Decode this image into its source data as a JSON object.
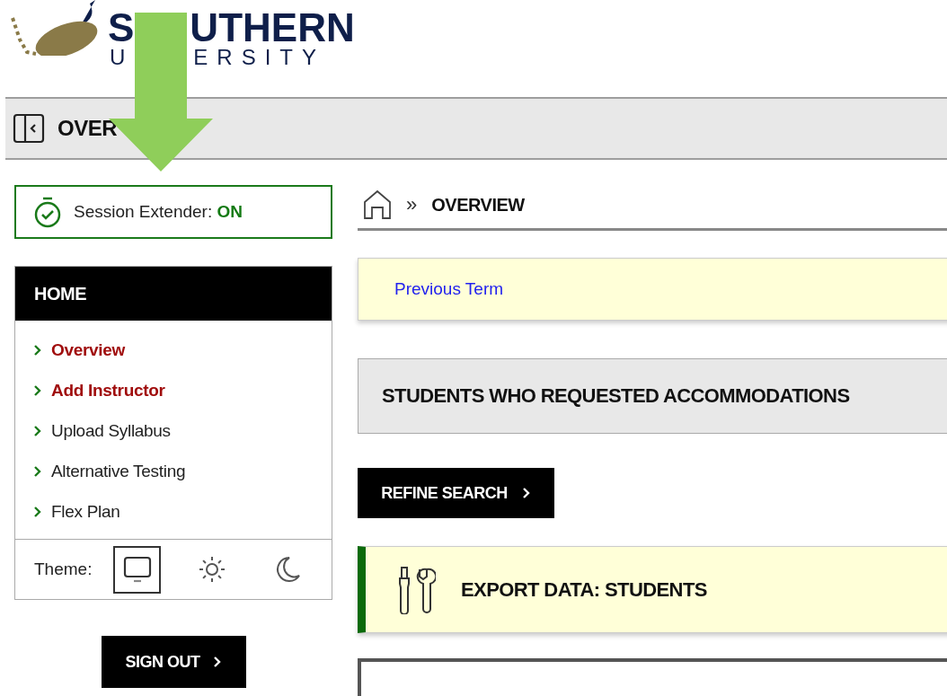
{
  "logo": {
    "top_parts": [
      "S",
      "UTHERN"
    ],
    "bottom_parts": [
      "U",
      "ERSITY"
    ]
  },
  "header": {
    "title": "OVER"
  },
  "session_extender": {
    "label": "Session Extender:",
    "status": "ON",
    "on": true
  },
  "sidebar": {
    "title": "HOME",
    "items": [
      {
        "label": "Overview",
        "highlighted": true
      },
      {
        "label": "Add Instructor",
        "highlighted": true
      },
      {
        "label": "Upload Syllabus",
        "highlighted": false
      },
      {
        "label": "Alternative Testing",
        "highlighted": false
      },
      {
        "label": "Flex Plan",
        "highlighted": false
      }
    ],
    "theme": {
      "label": "Theme:",
      "options": [
        {
          "kind": "system",
          "selected": true
        },
        {
          "kind": "light",
          "selected": false
        },
        {
          "kind": "dark",
          "selected": false
        }
      ]
    }
  },
  "sign_out": {
    "label": "SIGN OUT"
  },
  "breadcrumb": {
    "separator": "»",
    "current": "OVERVIEW"
  },
  "term_link": "Previous Term",
  "students_heading": "STUDENTS WHO REQUESTED ACCOMMODATIONS",
  "refine_button": "REFINE SEARCH",
  "export_heading": "EXPORT DATA: STUDENTS"
}
